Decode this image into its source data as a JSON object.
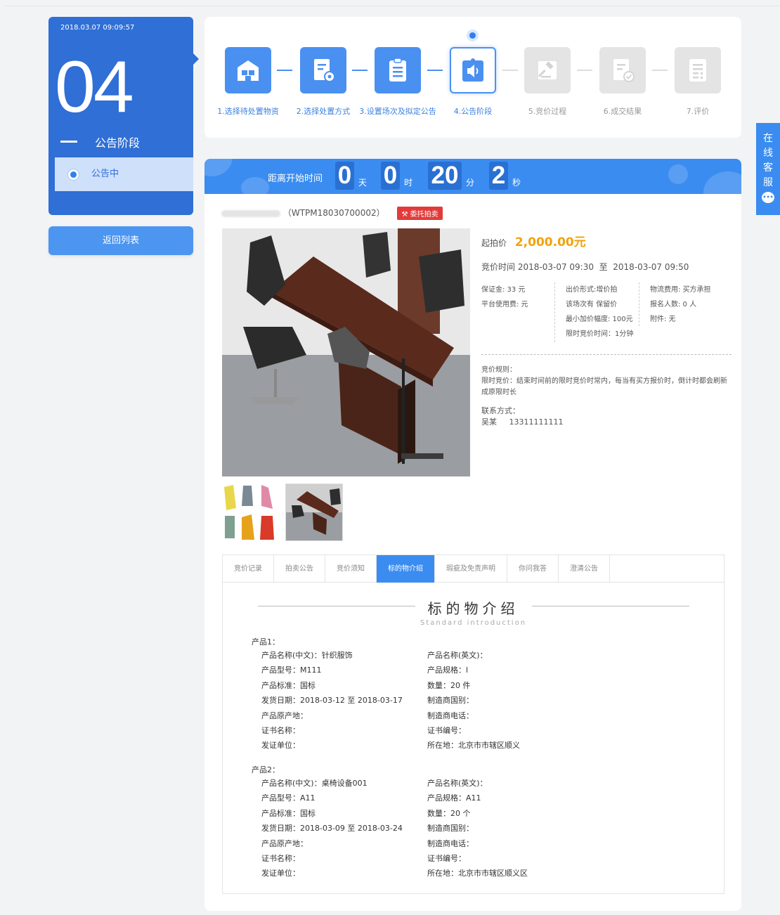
{
  "stage": {
    "datetime": "2018.03.07 09:09:57",
    "number": "04",
    "title": "公告阶段",
    "current_sub": "公告中",
    "back_label": "返回列表"
  },
  "steps": [
    {
      "label": "1.选择待处置物资",
      "state": "done",
      "icon": "warehouse-icon"
    },
    {
      "label": "2.选择处置方式",
      "state": "done",
      "icon": "form-settings-icon"
    },
    {
      "label": "3.设置场次及拟定公告",
      "state": "done",
      "icon": "clipboard-list-icon"
    },
    {
      "label": "4.公告阶段",
      "state": "active",
      "icon": "announcement-icon"
    },
    {
      "label": "5.竞价过程",
      "state": "todo",
      "icon": "gavel-icon"
    },
    {
      "label": "6.成交结果",
      "state": "todo",
      "icon": "document-check-icon"
    },
    {
      "label": "7.评价",
      "state": "todo",
      "icon": "rating-form-icon"
    }
  ],
  "countdown": {
    "label": "距离开始时间",
    "days": "0",
    "days_unit": "天",
    "hours": "0",
    "hours_unit": "时",
    "minutes": "20",
    "minutes_unit": "分",
    "seconds": "2",
    "seconds_unit": "秒"
  },
  "lot": {
    "code": "（WTPM18030700002）",
    "badge": "委托拍卖"
  },
  "info": {
    "price_label": "起拍价",
    "price_value": "2,000.00元",
    "time_label": "竞价时间",
    "time_start": "2018-03-07 09:30",
    "time_sep": "至",
    "time_end": "2018-03-07 09:50",
    "col1": [
      "保证金:  33  元",
      "平台使用费:      元"
    ],
    "col2": [
      "出价形式:增价拍",
      "该场次有 保留价",
      "最小加价幅度: 100元",
      "限时竞价时间：1分钟"
    ],
    "col3": [
      "物流费用:   买方承担",
      "报名人数:  0  人",
      "附件: 无"
    ],
    "rules_title": "竞价规则：",
    "rules_text": "限时竞价：结束时间前的限时竞价时常内，每当有买方报价时，倒计时都会刷新成原限时长",
    "contact_title": "联系方式：",
    "contact_name": "吴某",
    "contact_phone": "13311111111"
  },
  "tabs": [
    "竞价记录",
    "拍卖公告",
    "竞价须知",
    "标的物介绍",
    "瑕疵及免责声明",
    "你问我答",
    "澄清公告"
  ],
  "active_tab_index": 3,
  "section": {
    "title": "标的物介绍",
    "subtitle": "Standard introduction"
  },
  "products": [
    {
      "heading": "产品1：",
      "rows": [
        [
          "产品名称(中文)：针织服饰",
          "产品名称(英文)："
        ],
        [
          "产品型号：M111",
          "产品规格：l"
        ],
        [
          "产品标准：国标",
          "数量：20 件"
        ],
        [
          "发货日期：2018-03-12 至 2018-03-17",
          "制造商国别："
        ],
        [
          "产品原产地：",
          "制造商电话："
        ],
        [
          "证书名称：",
          "证书编号："
        ],
        [
          "发证单位：",
          "所在地：北京市市辖区顺义"
        ]
      ]
    },
    {
      "heading": "产品2：",
      "rows": [
        [
          "产品名称(中文)：桌椅设备001",
          "产品名称(英文)："
        ],
        [
          "产品型号：A11",
          "产品规格：A11"
        ],
        [
          "产品标准：国标",
          "数量：20 个"
        ],
        [
          "发货日期：2018-03-09 至 2018-03-24",
          "制造商国别："
        ],
        [
          "产品原产地：",
          "制造商电话："
        ],
        [
          "证书名称：",
          "证书编号："
        ],
        [
          "发证单位：",
          "所在地：北京市市辖区顺义区"
        ]
      ]
    }
  ],
  "side": {
    "service_chars": [
      "在",
      "线",
      "客",
      "服"
    ],
    "chat_icon": "chat-bubble-icon"
  },
  "colors": {
    "primary": "#2f6fd6",
    "accent": "#3a8cf0",
    "price": "#f2a20c",
    "badge": "#e23b3b"
  }
}
